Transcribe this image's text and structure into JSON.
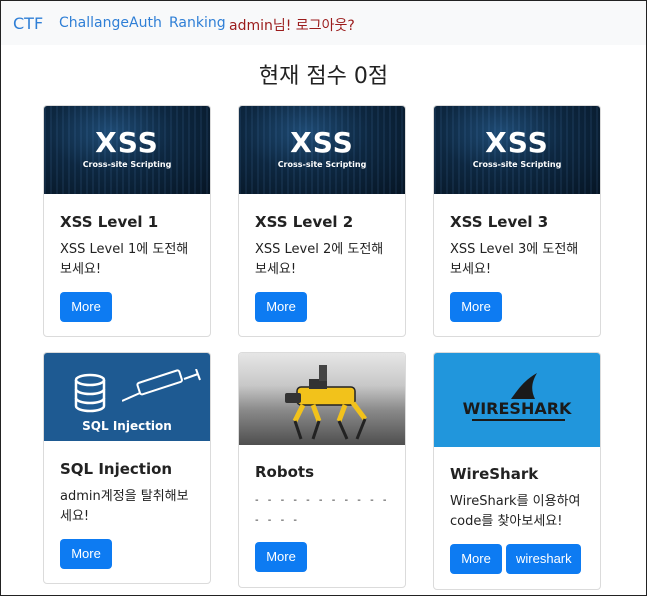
{
  "nav": {
    "brand": "CTF",
    "links": [
      "Challange",
      "Auth",
      "Ranking"
    ],
    "logout": "admin님! 로그아웃?"
  },
  "score_title": "현재 점수 0점",
  "cards": [
    {
      "title": "XSS Level 1",
      "text": "XSS Level 1에 도전해보세요!",
      "button": "More",
      "image_title": "XSS",
      "image_sub": "Cross-site Scripting"
    },
    {
      "title": "XSS Level 2",
      "text": "XSS Level 2에 도전해보세요!",
      "button": "More",
      "image_title": "XSS",
      "image_sub": "Cross-site Scripting"
    },
    {
      "title": "XSS Level 3",
      "text": "XSS Level 3에 도전해보세요!",
      "button": "More",
      "image_title": "XSS",
      "image_sub": "Cross-site Scripting"
    },
    {
      "title": "SQL Injection",
      "text": "admin계정을 탈취해보세요!",
      "button": "More",
      "image_title": "SQL Injection"
    },
    {
      "title": "Robots",
      "text": "",
      "button": "More"
    },
    {
      "title": "WireShark",
      "text": "WireShark를 이용하여 code를 찾아보세요!",
      "button": "More",
      "button2": "wireshark",
      "image_logo_a": "WIRE",
      "image_logo_b": "SHARK"
    }
  ]
}
